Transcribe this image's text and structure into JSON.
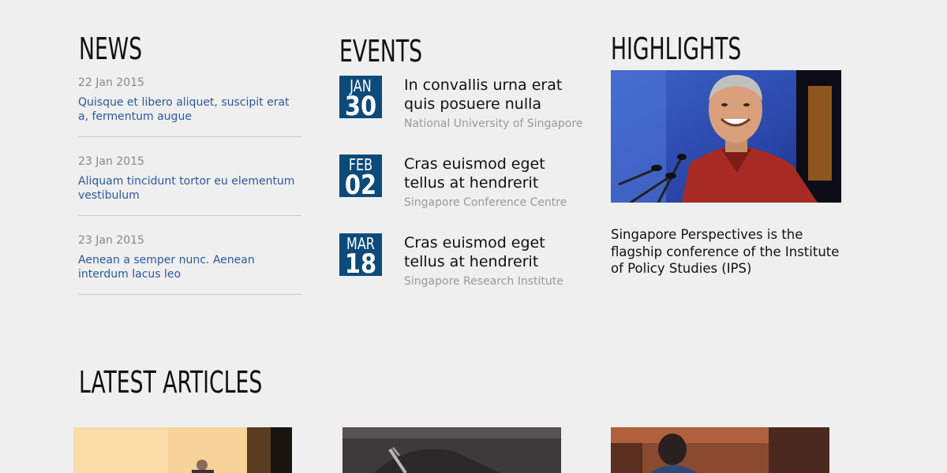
{
  "news": {
    "heading": "NEWS",
    "items": [
      {
        "date": "22 Jan 2015",
        "title": "Quisque et libero aliquet, suscipit erat a, fermentum augue"
      },
      {
        "date": "23 Jan 2015",
        "title": "Aliquam tincidunt tortor eu elementum vestibulum"
      },
      {
        "date": "23 Jan 2015",
        "title": "Aenean a semper nunc. Aenean interdum lacus leo"
      }
    ]
  },
  "events": {
    "heading": "EVENTS",
    "items": [
      {
        "month": "JAN",
        "day": "30",
        "title": "In convallis urna erat quis posuere nulla",
        "venue": "National University of Singapore"
      },
      {
        "month": "FEB",
        "day": "02",
        "title": "Cras euismod eget tellus at hendrerit",
        "venue": "Singapore Conference Centre"
      },
      {
        "month": "MAR",
        "day": "18",
        "title": "Cras euismod eget tellus at hendrerit",
        "venue": "Singapore Research Institute"
      }
    ],
    "calendar_color": "#0c4a79"
  },
  "highlights": {
    "heading": "HIGHLIGHTS",
    "caption": "Singapore Perspectives is the flagship conference of the Institute of Policy Studies (IPS)"
  },
  "articles": {
    "heading": "LATEST ARTICLES"
  },
  "colors": {
    "background": "#efefef",
    "link": "#2a5a9c",
    "muted": "#999999"
  }
}
